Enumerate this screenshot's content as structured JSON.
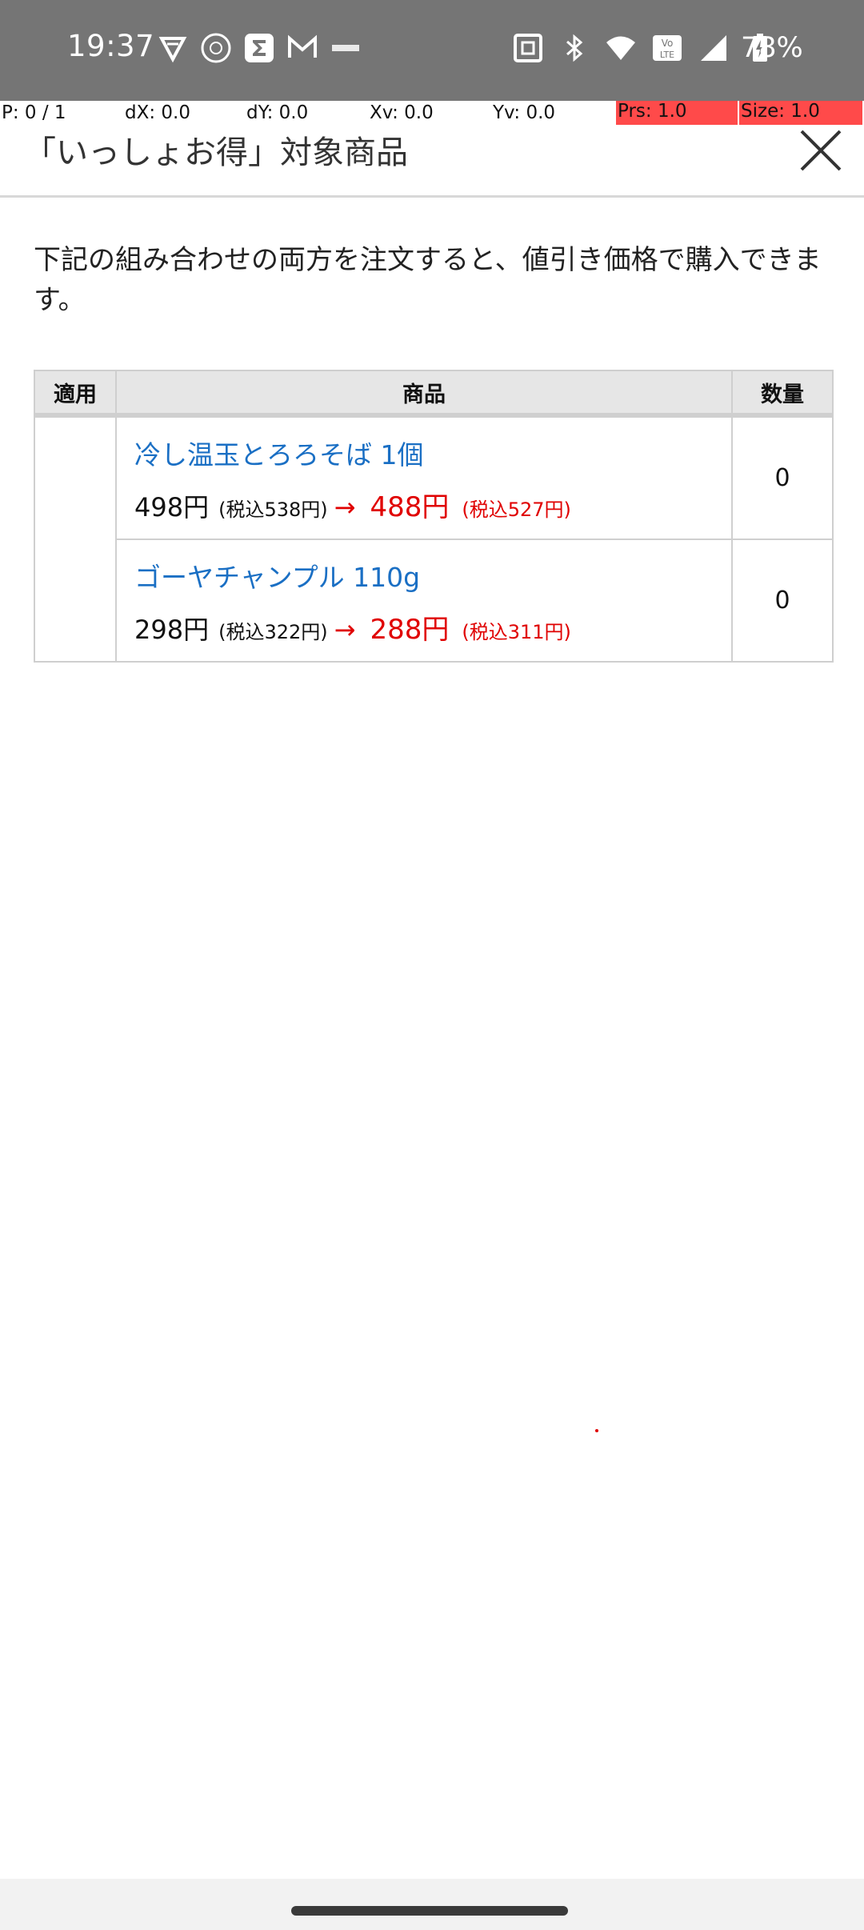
{
  "status_bar": {
    "time": "19:37",
    "battery": "78%",
    "left_icons": [
      "vpn-shield-icon",
      "app-circle-icon",
      "sigma-app-icon",
      "gmail-icon",
      "app-text-icon"
    ],
    "right_icons": [
      "nfc-icon",
      "bluetooth-icon",
      "wifi-icon",
      "volte-icon",
      "signal-icon",
      "battery-charging-icon"
    ]
  },
  "debug": {
    "pointer": "P: 0 / 1",
    "dx": "dX: 0.0",
    "dy": "dY: 0.0",
    "xv": "Xv: 0.0",
    "yv": "Yv: 0.0",
    "prs": "Prs: 1.0",
    "size": "Size: 1.0"
  },
  "header": {
    "title": "「いっしょお得」対象商品",
    "close_icon": "close-icon"
  },
  "description": "下記の組み合わせの両方を注文すると、値引き価格で購入できます。",
  "table": {
    "headers": {
      "apply": "適用",
      "item": "商品",
      "qty": "数量"
    },
    "rows": [
      {
        "name": "冷し温玉とろろそば 1個",
        "price": "498円",
        "price_tax": "(税込538円)",
        "arrow": "→",
        "discount_price": "488円",
        "discount_tax": "(税込527円)",
        "qty": "0"
      },
      {
        "name": "ゴーヤチャンプル 110g",
        "price": "298円",
        "price_tax": "(税込322円)",
        "arrow": "→",
        "discount_price": "288円",
        "discount_tax": "(税込311円)",
        "qty": "0"
      }
    ]
  },
  "colors": {
    "link": "#1a6fc4",
    "discount": "#e00000",
    "status_bar": "#757575"
  }
}
